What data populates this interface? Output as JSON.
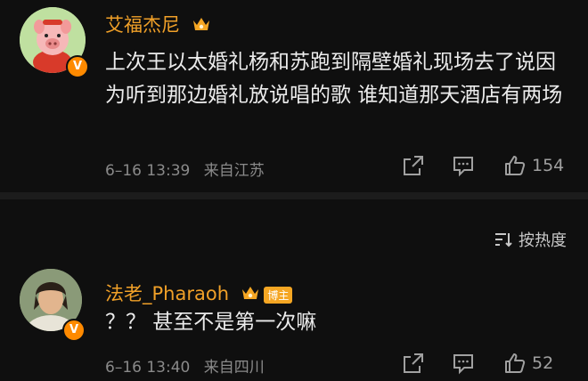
{
  "comments": [
    {
      "user": "艾福杰尼",
      "text": "上次王以太婚礼杨和苏跑到隔壁婚礼现场去了说因为听到那边婚礼放说唱的歌 谁知道那天酒店有两场",
      "date": "6–16 13:39",
      "location": "来自江苏",
      "likes": "154",
      "badge_icon": "crown-icon",
      "verified_icon": "v-badge-icon"
    },
    {
      "user": "法老_Pharaoh",
      "badge_label": "博主",
      "text": "？？ 甚至不是第一次嘛",
      "date": "6–16 13:40",
      "location": "来自四川",
      "likes": "52",
      "badge_icon": "crown-icon",
      "verified_icon": "v-badge-icon"
    }
  ],
  "verified_mark": "V",
  "sort": {
    "label": "按热度",
    "icon": "sort-icon"
  },
  "colors": {
    "background": "#0f0f0f",
    "username": "#f0a028",
    "meta": "#8a8a8a",
    "verified": "#ff8a00"
  }
}
